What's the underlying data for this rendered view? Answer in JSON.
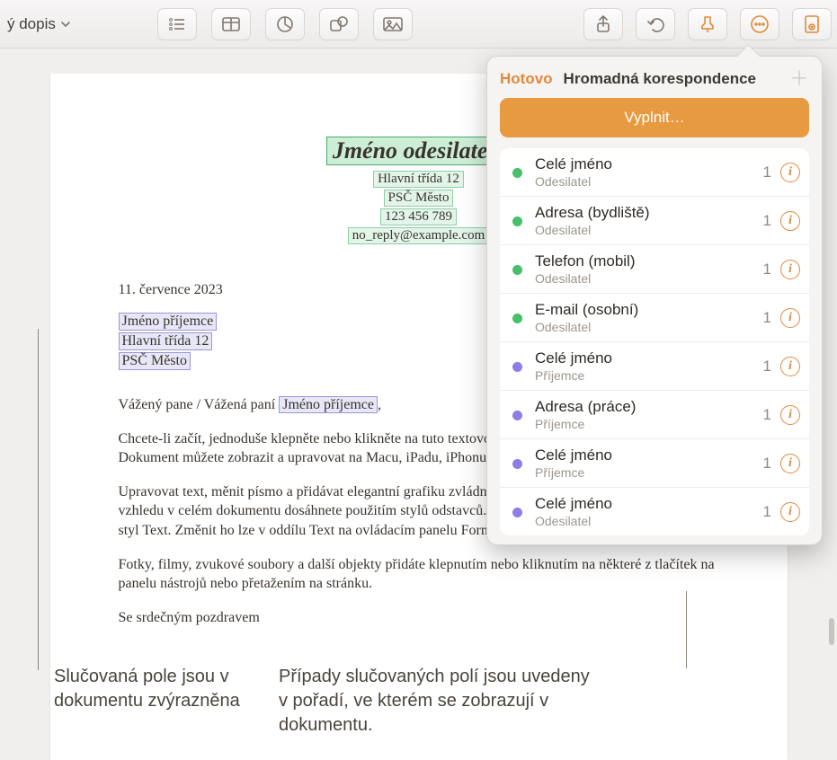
{
  "toolbar": {
    "doc_title": "ý dopis"
  },
  "document": {
    "sender": {
      "name": "Jméno odesilatele",
      "street": "Hlavní třída 12",
      "city": "PSČ Město",
      "phone": "123 456 789",
      "email": "no_reply@example.com"
    },
    "date": "11. července 2023",
    "recipient": {
      "name": "Jméno příjemce",
      "street": "Hlavní třída 12",
      "city": "PSČ Město"
    },
    "salutation_pre": "Vážený pane / Vážená paní ",
    "salutation_field": "Jméno příjemce",
    "salutation_post": ",",
    "p1": "Chcete-li začít, jednoduše klepněte nebo klikněte na tuto textovou oblast a pusťte se do psaní. Dokument můžete zobrazit a upravovat na Macu, iPadu, iPhonu i na webu iCloud.com.",
    "p2": "Upravovat text, měnit písmo a přidávat elegantní grafiku zvládnete docela jednoduše. Jednotného vzhledu v celém dokumentu dosáhnete použitím stylů odstavců. V tomto odstavci je například použitý styl Text. Změnit ho lze v oddílu Text na ovládacím panelu Formát.",
    "p3": "Fotky, filmy, zvukové soubory a další objekty přidáte klepnutím nebo kliknutím na některé z tlačítek na panelu nástrojů nebo přetažením na stránku.",
    "signoff": "Se srdečným pozdravem"
  },
  "popover": {
    "done": "Hotovo",
    "title": "Hromadná korespondence",
    "fill": "Vyplnit…",
    "fields": [
      {
        "name": "Celé jméno",
        "sub": "Odesilatel",
        "count": "1",
        "color": "green"
      },
      {
        "name": "Adresa (bydliště)",
        "sub": "Odesilatel",
        "count": "1",
        "color": "green"
      },
      {
        "name": "Telefon (mobil)",
        "sub": "Odesilatel",
        "count": "1",
        "color": "green"
      },
      {
        "name": "E-mail (osobní)",
        "sub": "Odesilatel",
        "count": "1",
        "color": "green"
      },
      {
        "name": "Celé jméno",
        "sub": "Příjemce",
        "count": "1",
        "color": "purple"
      },
      {
        "name": "Adresa (práce)",
        "sub": "Příjemce",
        "count": "1",
        "color": "purple"
      },
      {
        "name": "Celé jméno",
        "sub": "Příjemce",
        "count": "1",
        "color": "purple"
      },
      {
        "name": "Celé jméno",
        "sub": "Odesilatel",
        "count": "1",
        "color": "purple"
      }
    ]
  },
  "callouts": {
    "left": "Slučovaná pole jsou v dokumentu zvýrazněna",
    "right": "Případy slučovaných polí jsou uvedeny v pořadí, ve kterém se zobrazují v dokumentu."
  }
}
